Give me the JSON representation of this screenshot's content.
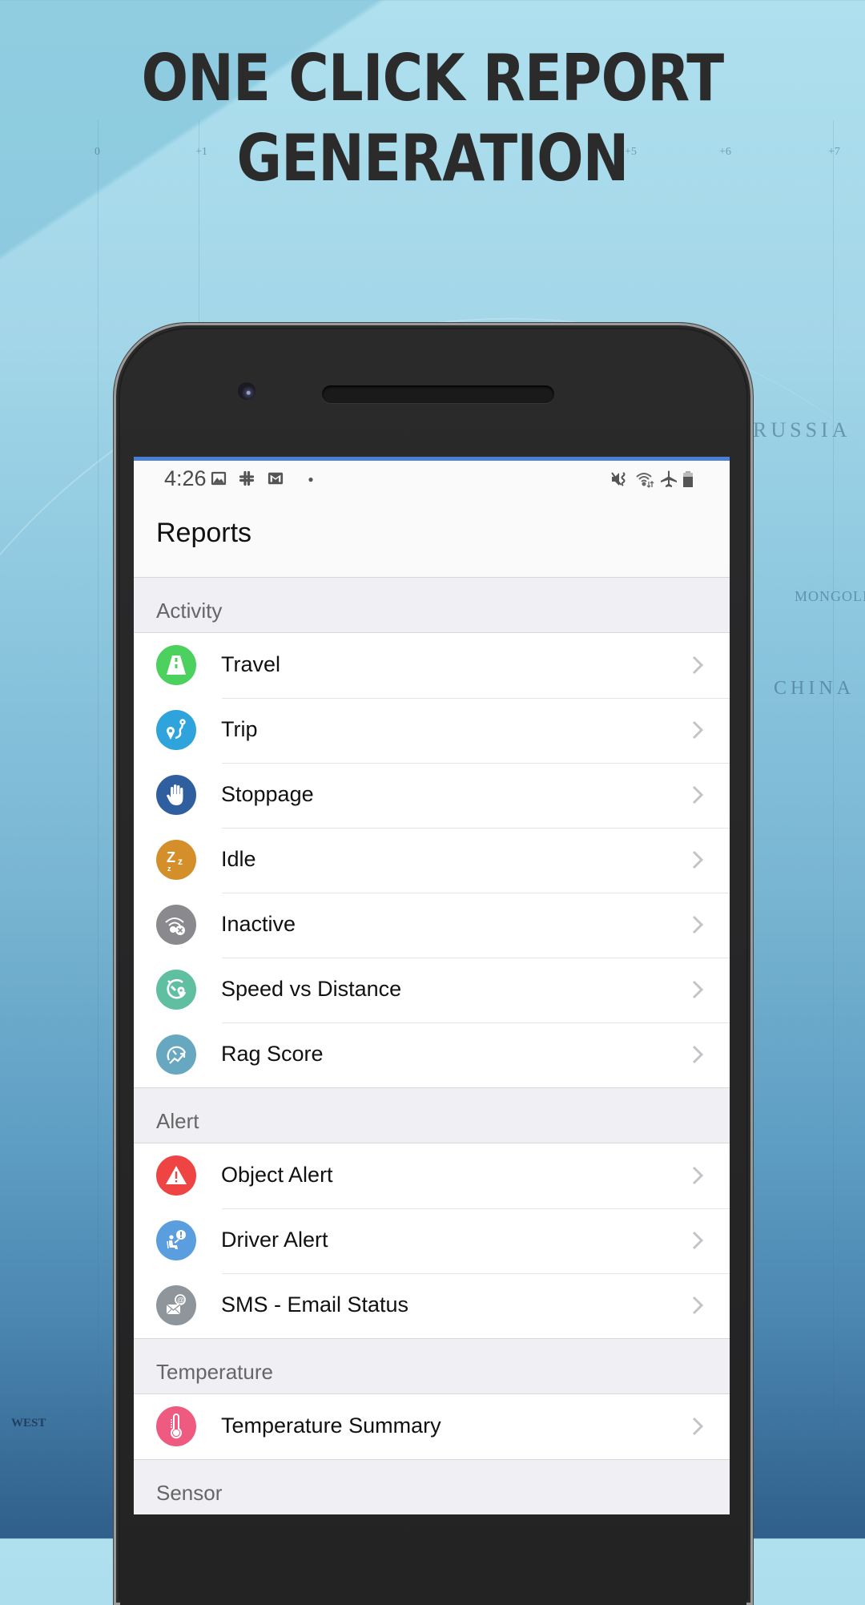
{
  "promo": {
    "headline_line1": "ONE CLICK REPORT",
    "headline_line2": "GENERATION"
  },
  "background_map": {
    "labels": [
      "RUSSIA",
      "MONGOLIA",
      "CHINA",
      "WEST"
    ],
    "time_zone_numbers": [
      "0",
      "+1",
      "+5",
      "+6",
      "+7"
    ]
  },
  "status_bar": {
    "time": "4:26",
    "left_icons": [
      "image-icon",
      "slack-icon",
      "gmail-icon",
      "dot-icon"
    ],
    "right_icons": [
      "mute-vibrate-icon",
      "wifi-icon",
      "airplane-mode-icon",
      "battery-icon"
    ]
  },
  "header": {
    "title": "Reports"
  },
  "colors": {
    "accent": "#4a7fd4",
    "travel": "#4cd05e",
    "trip": "#2fa3dc",
    "stoppage": "#2f5f9f",
    "idle": "#d48f2a",
    "inactive": "#8a8a8e",
    "speed_vs_distance": "#5fbfa0",
    "rag_score": "#67a8c0",
    "object_alert": "#ef4444",
    "driver_alert": "#5a9ee0",
    "sms_email_status": "#8e959b",
    "temperature_summary": "#ee5a80"
  },
  "sections": [
    {
      "label": "Activity",
      "items": [
        {
          "label": "Travel",
          "icon": "road-icon"
        },
        {
          "label": "Trip",
          "icon": "route-pin-icon"
        },
        {
          "label": "Stoppage",
          "icon": "hand-stop-icon"
        },
        {
          "label": "Idle",
          "icon": "sleep-zzz-icon"
        },
        {
          "label": "Inactive",
          "icon": "signal-off-icon"
        },
        {
          "label": "Speed vs Distance",
          "icon": "speed-distance-icon"
        },
        {
          "label": "Rag Score",
          "icon": "gauge-trend-icon"
        }
      ]
    },
    {
      "label": "Alert",
      "items": [
        {
          "label": "Object Alert",
          "icon": "warning-triangle-icon"
        },
        {
          "label": "Driver Alert",
          "icon": "driver-alert-icon"
        },
        {
          "label": "SMS - Email Status",
          "icon": "email-at-icon"
        }
      ]
    },
    {
      "label": "Temperature",
      "items": [
        {
          "label": "Temperature Summary",
          "icon": "thermometer-icon"
        }
      ]
    },
    {
      "label": "Sensor",
      "items": []
    }
  ]
}
